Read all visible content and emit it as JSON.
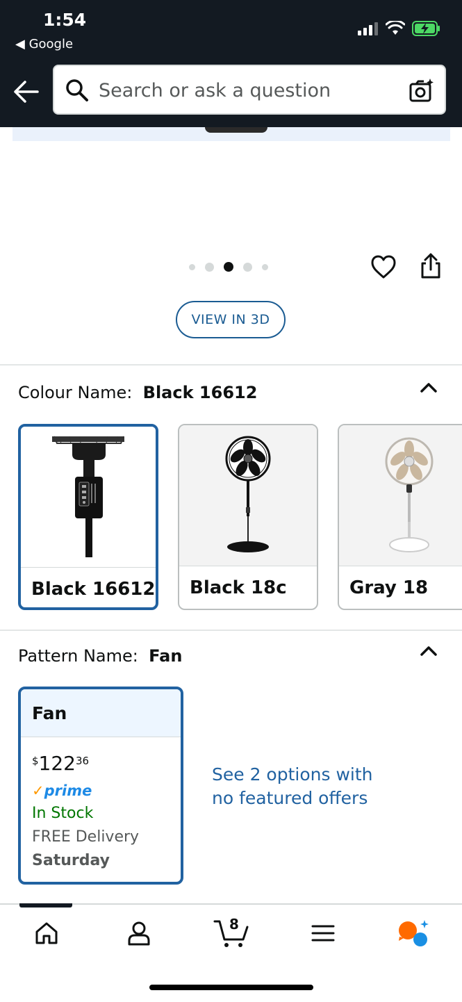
{
  "status_bar": {
    "time": "1:54",
    "back_app": "◀ Google"
  },
  "search": {
    "placeholder": "Search or ask a question"
  },
  "gallery": {
    "dot_count": 5,
    "active_dot_index": 2,
    "view_3d_label": "VIEW IN 3D"
  },
  "colour": {
    "label": "Colour Name:",
    "selected_value": "Black 16612",
    "options": [
      {
        "name": "Black 16612",
        "selected": true
      },
      {
        "name": "Black 18c",
        "selected": false
      },
      {
        "name": "Gray 18",
        "selected": false
      }
    ]
  },
  "pattern": {
    "label": "Pattern Name:",
    "selected_value": "Fan",
    "card": {
      "title": "Fan",
      "price_symbol": "$",
      "price_whole": "122",
      "price_fraction": "36",
      "prime_check": "✓",
      "prime_label": "prime",
      "stock": "In Stock",
      "delivery": "FREE Delivery",
      "delivery_day": "Saturday"
    },
    "see_options": "See 2 options with no featured offers"
  },
  "bottom_nav": {
    "cart_count": "8",
    "items": [
      "home-icon",
      "account-icon",
      "cart-icon",
      "menu-icon",
      "assistant-icon"
    ]
  },
  "colors": {
    "header_bg": "#131a22",
    "selected_border": "#2162a1",
    "link": "#2162a1",
    "in_stock": "#007600",
    "prime_blue": "#1d8ae6",
    "prime_check": "#ff9900"
  }
}
